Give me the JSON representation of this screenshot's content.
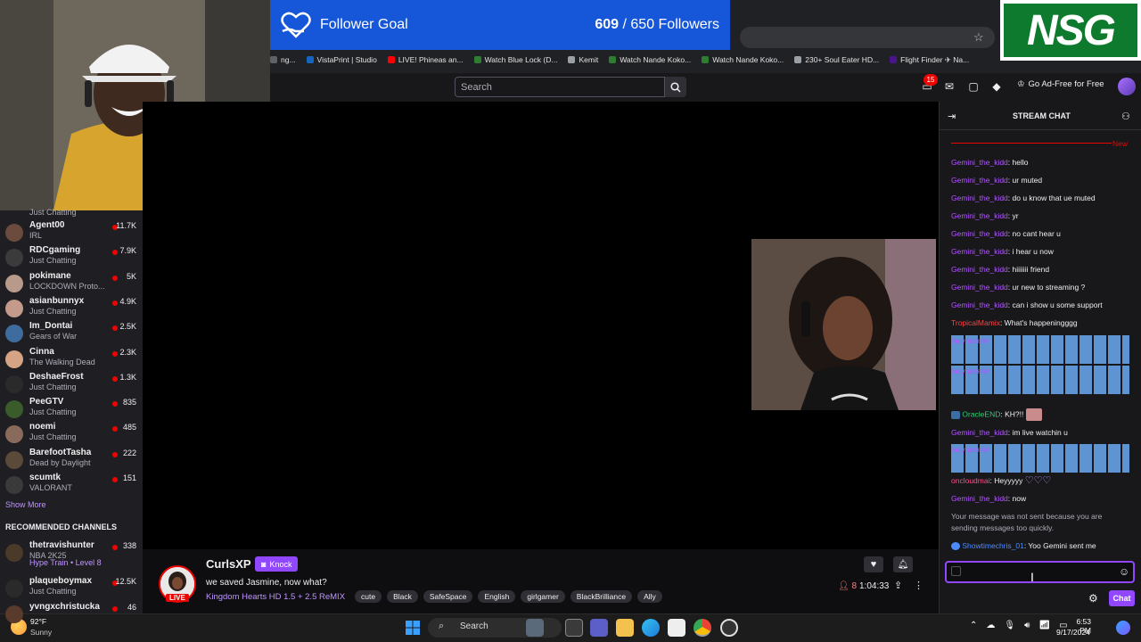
{
  "goal": {
    "title": "Follower Goal",
    "current": "609",
    "target": "/ 650 Followers"
  },
  "logo_text": "NSG",
  "bookmarks": [
    {
      "label": "ng...",
      "color": "#5f6368"
    },
    {
      "label": "VistaPrint | Studio",
      "color": "#1565c0"
    },
    {
      "label": "LIVE! Phineas an...",
      "color": "#ff0000"
    },
    {
      "label": "Watch Blue Lock (D...",
      "color": "#2e7d32"
    },
    {
      "label": "Kemit",
      "color": "#9aa0a6"
    },
    {
      "label": "Watch Nande Koko...",
      "color": "#2e7d32"
    },
    {
      "label": "Watch Nande Koko...",
      "color": "#2e7d32"
    },
    {
      "label": "230+ Soul Eater HD...",
      "color": "#9aa0a6"
    },
    {
      "label": "Flight Finder ✈ Na...",
      "color": "#4a148c"
    }
  ],
  "nav": {
    "search_placeholder": "Search",
    "notif_count": "15",
    "adfree_label": "Go Ad-Free for Free"
  },
  "sidebar": {
    "partial_label": "Just Chatting",
    "channels": [
      {
        "name": "Agent00",
        "game": "IRL",
        "viewers": "11.7K",
        "color": "#6b4b3e"
      },
      {
        "name": "RDCgaming",
        "game": "Just Chatting",
        "viewers": "7.9K",
        "color": "#3b3b3b"
      },
      {
        "name": "pokimane",
        "game": "LOCKDOWN Proto...",
        "viewers": "5K",
        "color": "#b89a8a"
      },
      {
        "name": "asianbunnyx",
        "game": "Just Chatting",
        "viewers": "4.9K",
        "color": "#c49a8a"
      },
      {
        "name": "Im_Dontai",
        "game": "Gears of War",
        "viewers": "2.5K",
        "color": "#3f6c9f"
      },
      {
        "name": "Cinna",
        "game": "The Walking Dead",
        "viewers": "2.3K",
        "color": "#d6a384"
      },
      {
        "name": "DeshaeFrost",
        "game": "Just Chatting",
        "viewers": "1.3K",
        "color": "#2a2a2a"
      },
      {
        "name": "PeeGTV",
        "game": "Just Chatting",
        "viewers": "835",
        "color": "#3a5c2a"
      },
      {
        "name": "noemi",
        "game": "Just Chatting",
        "viewers": "485",
        "color": "#8a6a5a"
      },
      {
        "name": "BarefootTasha",
        "game": "Dead by Daylight",
        "viewers": "222",
        "color": "#5a4a3a"
      },
      {
        "name": "scumtk",
        "game": "VALORANT",
        "viewers": "151",
        "color": "#3a3a3a"
      }
    ],
    "show_more": "Show More",
    "recommended_heading": "RECOMMENDED CHANNELS",
    "recommended": [
      {
        "name": "thetravishunter",
        "game": "NBA 2K25",
        "viewers": "338",
        "color": "#4a3a2a"
      },
      {
        "name": "",
        "game": "Hype Train • Level 8",
        "viewers": "",
        "color": ""
      },
      {
        "name": "plaqueboymax",
        "game": "Just Chatting",
        "viewers": "12.5K",
        "color": "#2a2a2a"
      },
      {
        "name": "yvngxchristucka",
        "game": "",
        "viewers": "46",
        "color": "#5a3a2a"
      }
    ]
  },
  "stream": {
    "streamer": "CurlsXP",
    "live_label": "LIVE",
    "knock_label": "Knock",
    "title": "we saved Jasmine, now what?",
    "game": "Kingdom Hearts HD 1.5 + 2.5 ReMIX",
    "tags": [
      "cute",
      "Black",
      "SafeSpace",
      "English",
      "girlgamer",
      "BlackBrilliance",
      "Ally"
    ],
    "viewers": "8",
    "uptime": "1:04:33"
  },
  "chat": {
    "title": "STREAM CHAT",
    "new_label": "New",
    "messages": [
      {
        "user": "Gemini_the_kidd",
        "color": "#b157ff",
        "text": ": hello"
      },
      {
        "user": "Gemini_the_kidd",
        "color": "#b157ff",
        "text": ": ur muted"
      },
      {
        "user": "Gemini_the_kidd",
        "color": "#b157ff",
        "text": ": do u know that ue muted"
      },
      {
        "user": "Gemini_the_kidd",
        "color": "#b157ff",
        "text": ": yr"
      },
      {
        "user": "Gemini_the_kidd",
        "color": "#b157ff",
        "text": ": no cant hear u"
      },
      {
        "user": "Gemini_the_kidd",
        "color": "#b157ff",
        "text": ": i hear u now"
      },
      {
        "user": "Gemini_the_kidd",
        "color": "#b157ff",
        "text": ": hiiiiiii friend"
      },
      {
        "user": "Gemini_the_kidd",
        "color": "#b157ff",
        "text": ": ur new to streaming ?"
      },
      {
        "user": "Gemini_the_kidd",
        "color": "#b157ff",
        "text": ": can i show u some support"
      },
      {
        "user": "TropicalMamix",
        "color": "#ff4040",
        "text": ": What's happeningggg"
      }
    ],
    "emote_user": "ladyhazeltv",
    "oracle": {
      "user": "OracleEND",
      "color": "#2ecc71",
      "text": ": KH?!!"
    },
    "msg_live": {
      "user": "Gemini_the_kidd",
      "color": "#b157ff",
      "text": ": im live watchin u"
    },
    "oncloud": {
      "user": "oncloudmai",
      "color": "#ff4d88",
      "text": ": Heyyyyy"
    },
    "msg_now": {
      "user": "Gemini_the_kidd",
      "color": "#b157ff",
      "text": ": now"
    },
    "system": "Your message was not sent because you are sending messages too quickly.",
    "last": {
      "user": "Showtimechris_01",
      "color": "#4b8bff",
      "text": ": Yoo Gemini sent me"
    },
    "send_label": "Chat"
  },
  "taskbar": {
    "temp": "92°F",
    "condition": "Sunny",
    "search": "Search",
    "time": "6:53 PM",
    "date": "9/17/2024"
  }
}
